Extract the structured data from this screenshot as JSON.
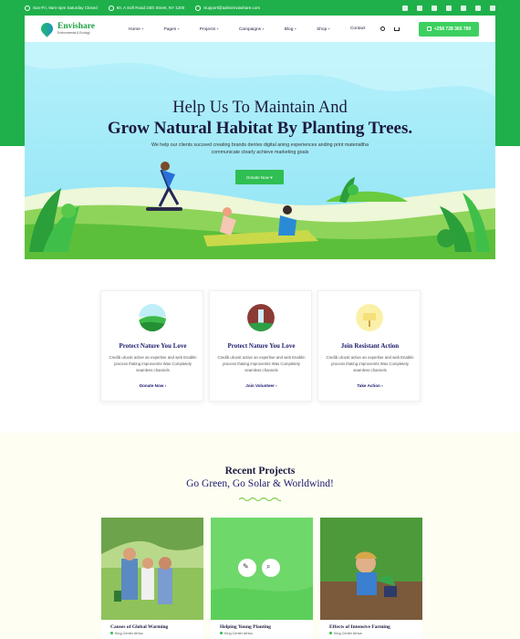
{
  "topbar": {
    "hours": "Sun-Fri, 9am-4pm Saturday Closed",
    "address": "60, A Soft Road 24th Street, NY 1200",
    "email": "Support@admienviashare.com",
    "socials": [
      "twitter-icon",
      "facebook-icon",
      "vimeo-icon",
      "skype-icon",
      "behance-icon",
      "instagram-icon",
      "vk-icon"
    ]
  },
  "header": {
    "logo_name": "Envishare",
    "logo_tag": "Environmental & Ecology",
    "nav": [
      "Home",
      "Pages",
      "Projects",
      "Campaigns",
      "Blog",
      "Shop",
      "Contact"
    ],
    "phone": "+258 728 365 789"
  },
  "hero": {
    "line1": "Help Us To Maintain And",
    "line2": "Grow Natural Habitat By Planting Trees.",
    "subtitle_1": "We help our clients succeed creating brands dentes digital aning experiences anding print materialtha",
    "subtitle_2": "communicate clearly achieve marketing goals",
    "button": "Donate Now"
  },
  "features": [
    {
      "title": "Protect Nature You Love",
      "desc": "Credib ulcosit active an expertise and web Enablin process thating improvemts Was Completely seamless channels",
      "link": "Donate Now",
      "icon": "landscape-icon"
    },
    {
      "title": "Protect Nature You Love",
      "desc": "Credib ulcosit active an expertise and web Enablin process thating improvemts Was Completely seamless channels",
      "link": "Join Volunteer",
      "icon": "waterfall-icon"
    },
    {
      "title": "Join Resistant Action",
      "desc": "Credib ulcosit active an expertise and web Enablin process thating improvemts Was Completely seamless channels",
      "link": "Take Action",
      "icon": "sign-icon"
    }
  ],
  "projects": {
    "heading": "Recent Projects",
    "subheading": "Go Green, Go Solar & Worldwind!",
    "items": [
      {
        "title": "Causes of Global Warming",
        "location": "King Center Africa"
      },
      {
        "title": "Helping Young Planting",
        "location": "King Center Africa"
      },
      {
        "title": "Effects of Intensive Farming",
        "location": "King Center Africa"
      }
    ]
  },
  "colors": {
    "brand_green": "#1fb04b",
    "button_green": "#3cd05f",
    "navy": "#1c1a3e",
    "sky": "#a8ecfa"
  }
}
